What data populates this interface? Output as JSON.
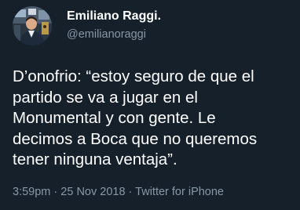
{
  "author": {
    "name": "Emiliano Raggi.",
    "handle": "@emilianoraggi",
    "avatar_icon": "profile-photo"
  },
  "tweet": {
    "lines": [
      "D’onofrio: “estoy seguro de que el",
      "partido se va a jugar en el",
      "Monumental y con gente. Le",
      "decimos a Boca que no queremos",
      "tener ninguna ventaja”."
    ]
  },
  "meta": {
    "time": "3:59pm",
    "separator": "·",
    "date": "25 Nov 2018",
    "source": "Twitter for iPhone"
  },
  "colors": {
    "background": "#15202b",
    "primary_text": "#ffffff",
    "secondary_text": "#8899a6"
  }
}
